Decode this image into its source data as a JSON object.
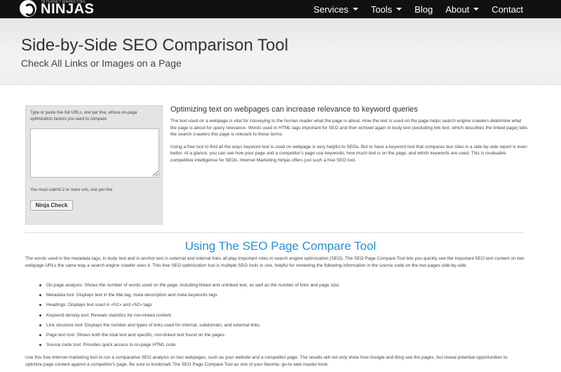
{
  "header": {
    "logo_tagline": "INTERNET MARKETING",
    "logo_brand": "NINJAS",
    "nav": [
      {
        "label": "Services",
        "has_dropdown": true
      },
      {
        "label": "Tools",
        "has_dropdown": true
      },
      {
        "label": "Blog",
        "has_dropdown": false
      },
      {
        "label": "About",
        "has_dropdown": true
      },
      {
        "label": "Contact",
        "has_dropdown": false
      }
    ]
  },
  "hero": {
    "title": "Side-by-Side SEO Comparison Tool",
    "subtitle": "Check All Links or Images on a Page"
  },
  "tool": {
    "instructions": "Type or paste five full URLs, one per line, whose on-page optimization factors you want to compare",
    "textarea_value": "",
    "note": "You must submit 2 or more urls, one per line",
    "button_label": "Ninja Check"
  },
  "intro": {
    "heading": "Optimizing text on webpages can increase relevance to keyword queries",
    "paragraphs": [
      "The text used on a webpage is vital for conveying to the human reader what the page is about. How the text is used on the page helps search engine crawlers determine what the page is about for query relevance. Words used in HTML tags important for SEO and then echoed again in body text (excluding link text, which describes the linked page) tells the search crawlers this page is relevant to these terms.",
      "Using a free tool to find all the ways keyword text is used on webpage is very helpful to SEOs. But to have a keyword tool that compares two sites in a side-by-side report is even better. At a glance, you can see how your page and a competitor's page use keywords, how much text is on the page, and which keywords are used. This is invaluable competitive intelligence for SEOs. Internet Marketing Ninjas offers just such a free SEO tool."
    ]
  },
  "section": {
    "title": "Using The SEO Page Compare Tool",
    "intro": "The words used in the metadata tags, in body text and in anchor text in external and internal links all play important roles in search engine optimization (SEO). The SEO Page Compare Tool lets you quickly see the important SEO text content on two webpage URLs the same way a search engine crawler sees it. This free SEO optimization tool is multiple SEO tools in one, helpful for reviewing the following information in the source code on the two pages side-by-side:",
    "features": [
      "On-page analysis: Shows the number of words used on the page, including linked and unlinked text, as well as the number of links and page size.",
      "Metadata tool: Displays text in the title tag, meta description and meta keywords tags",
      "Headings: Displays text used in <h1> and <h2> tags",
      "Keyword density tool: Reveals statistics for non-linked content",
      "Link structure tool: Displays the number and types of links used for internal, subdomain, and external links",
      "Page text tool: Shows both the total text and specific, non-linked text found on the pages",
      "Source code tool: Provides quick access to on-page HTML code"
    ],
    "closing": "Use this free Internet marketing tool to run a comparative SEO analysis on two webpages, such as your website and a competitor page. The results will not only show how Google and Bing see the pages, but reveal potential opportunities to optimize page content against a competitor's page. Be sure to bookmark The SEO Page Compare Tool as one of your favorite, go-to web master tools."
  }
}
